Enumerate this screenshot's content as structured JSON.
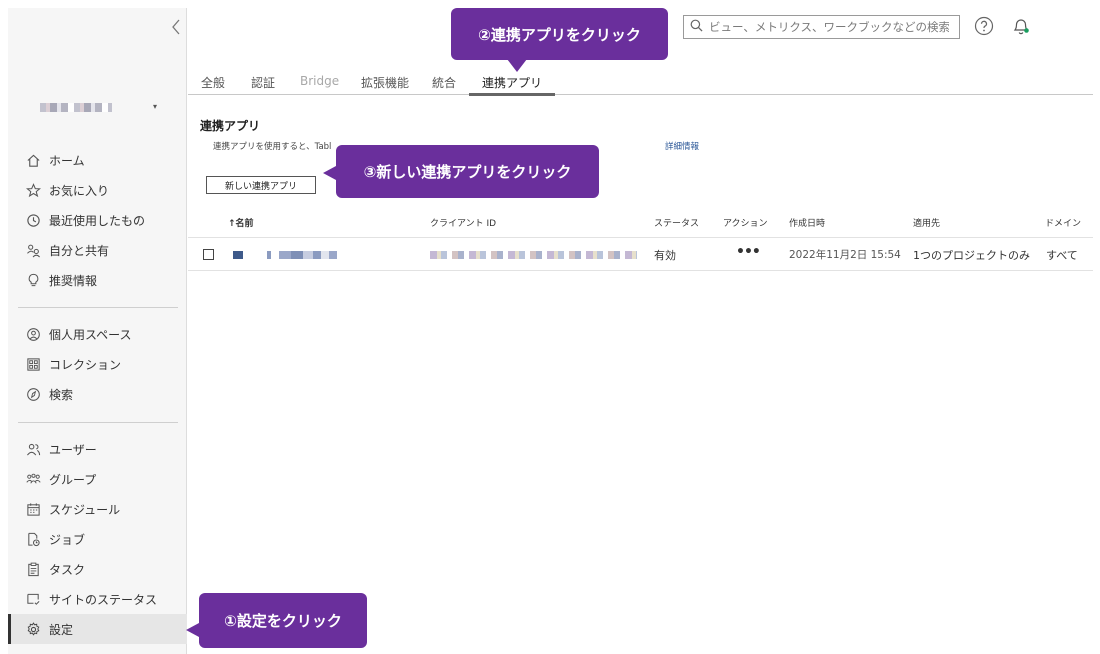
{
  "sidebar": {
    "collapse_icon": "chevron-left-icon",
    "site_switcher": {
      "caret": "▾"
    },
    "group1": [
      {
        "label": "ホーム",
        "icon": "home-icon"
      },
      {
        "label": "お気に入り",
        "icon": "star-icon"
      },
      {
        "label": "最近使用したもの",
        "icon": "clock-icon"
      },
      {
        "label": "自分と共有",
        "icon": "shared-users-icon"
      },
      {
        "label": "推奨情報",
        "icon": "lightbulb-icon"
      }
    ],
    "group2": [
      {
        "label": "個人用スペース",
        "icon": "personal-space-icon"
      },
      {
        "label": "コレクション",
        "icon": "collection-icon"
      },
      {
        "label": "検索",
        "icon": "compass-icon"
      }
    ],
    "group3": [
      {
        "label": "ユーザー",
        "icon": "users-icon"
      },
      {
        "label": "グループ",
        "icon": "group-icon"
      },
      {
        "label": "スケジュール",
        "icon": "calendar-icon"
      },
      {
        "label": "ジョブ",
        "icon": "job-icon"
      },
      {
        "label": "タスク",
        "icon": "task-icon"
      },
      {
        "label": "サイトのステータス",
        "icon": "site-status-icon"
      },
      {
        "label": "設定",
        "icon": "gear-icon",
        "active": true
      }
    ]
  },
  "header": {
    "search": {
      "placeholder": "ビュー、メトリクス、ワークブックなどの検索",
      "value": ""
    },
    "help_icon": "question-circle-icon",
    "bell_icon": "bell-icon",
    "notification_dot_color": "#1a9e5f"
  },
  "tabs": [
    {
      "label": "全般"
    },
    {
      "label": "認証"
    },
    {
      "label": "Bridge",
      "disabled": true
    },
    {
      "label": "拡張機能"
    },
    {
      "label": "統合"
    },
    {
      "label": "連携アプリ",
      "active": true
    }
  ],
  "main": {
    "title": "連携アプリ",
    "description_prefix": "連携アプリを使用すると、Tabl",
    "description_link": "詳細情報",
    "new_app_button": "新しい連携アプリ"
  },
  "table": {
    "columns": [
      "↑名前",
      "クライアント ID",
      "ステータス",
      "アクション",
      "作成日時",
      "適用先",
      "ドメイン"
    ],
    "rows": [
      {
        "status": "有効",
        "actions": "•••",
        "created": "2022年11月2日 15:54",
        "applies_to": "1つのプロジェクトのみ",
        "domain": "すべて"
      }
    ]
  },
  "callouts": {
    "step1": "①設定をクリック",
    "step2": "②連携アプリをクリック",
    "step3": "③新しい連携アプリをクリック"
  },
  "colors": {
    "callout": "#6a2f9c",
    "link": "#2b5797",
    "active_tab_underline": "#666666"
  }
}
